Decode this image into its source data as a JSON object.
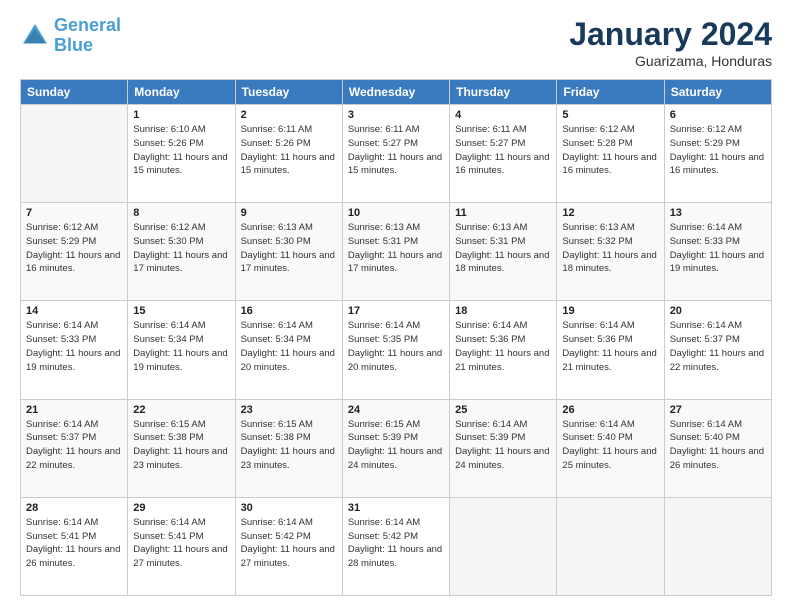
{
  "header": {
    "logo_line1": "General",
    "logo_line2": "Blue",
    "month": "January 2024",
    "location": "Guarizama, Honduras"
  },
  "days_of_week": [
    "Sunday",
    "Monday",
    "Tuesday",
    "Wednesday",
    "Thursday",
    "Friday",
    "Saturday"
  ],
  "weeks": [
    [
      {
        "date": "",
        "sunrise": "",
        "sunset": "",
        "daylight": ""
      },
      {
        "date": "1",
        "sunrise": "Sunrise: 6:10 AM",
        "sunset": "Sunset: 5:26 PM",
        "daylight": "Daylight: 11 hours and 15 minutes."
      },
      {
        "date": "2",
        "sunrise": "Sunrise: 6:11 AM",
        "sunset": "Sunset: 5:26 PM",
        "daylight": "Daylight: 11 hours and 15 minutes."
      },
      {
        "date": "3",
        "sunrise": "Sunrise: 6:11 AM",
        "sunset": "Sunset: 5:27 PM",
        "daylight": "Daylight: 11 hours and 15 minutes."
      },
      {
        "date": "4",
        "sunrise": "Sunrise: 6:11 AM",
        "sunset": "Sunset: 5:27 PM",
        "daylight": "Daylight: 11 hours and 16 minutes."
      },
      {
        "date": "5",
        "sunrise": "Sunrise: 6:12 AM",
        "sunset": "Sunset: 5:28 PM",
        "daylight": "Daylight: 11 hours and 16 minutes."
      },
      {
        "date": "6",
        "sunrise": "Sunrise: 6:12 AM",
        "sunset": "Sunset: 5:29 PM",
        "daylight": "Daylight: 11 hours and 16 minutes."
      }
    ],
    [
      {
        "date": "7",
        "sunrise": "Sunrise: 6:12 AM",
        "sunset": "Sunset: 5:29 PM",
        "daylight": "Daylight: 11 hours and 16 minutes."
      },
      {
        "date": "8",
        "sunrise": "Sunrise: 6:12 AM",
        "sunset": "Sunset: 5:30 PM",
        "daylight": "Daylight: 11 hours and 17 minutes."
      },
      {
        "date": "9",
        "sunrise": "Sunrise: 6:13 AM",
        "sunset": "Sunset: 5:30 PM",
        "daylight": "Daylight: 11 hours and 17 minutes."
      },
      {
        "date": "10",
        "sunrise": "Sunrise: 6:13 AM",
        "sunset": "Sunset: 5:31 PM",
        "daylight": "Daylight: 11 hours and 17 minutes."
      },
      {
        "date": "11",
        "sunrise": "Sunrise: 6:13 AM",
        "sunset": "Sunset: 5:31 PM",
        "daylight": "Daylight: 11 hours and 18 minutes."
      },
      {
        "date": "12",
        "sunrise": "Sunrise: 6:13 AM",
        "sunset": "Sunset: 5:32 PM",
        "daylight": "Daylight: 11 hours and 18 minutes."
      },
      {
        "date": "13",
        "sunrise": "Sunrise: 6:14 AM",
        "sunset": "Sunset: 5:33 PM",
        "daylight": "Daylight: 11 hours and 19 minutes."
      }
    ],
    [
      {
        "date": "14",
        "sunrise": "Sunrise: 6:14 AM",
        "sunset": "Sunset: 5:33 PM",
        "daylight": "Daylight: 11 hours and 19 minutes."
      },
      {
        "date": "15",
        "sunrise": "Sunrise: 6:14 AM",
        "sunset": "Sunset: 5:34 PM",
        "daylight": "Daylight: 11 hours and 19 minutes."
      },
      {
        "date": "16",
        "sunrise": "Sunrise: 6:14 AM",
        "sunset": "Sunset: 5:34 PM",
        "daylight": "Daylight: 11 hours and 20 minutes."
      },
      {
        "date": "17",
        "sunrise": "Sunrise: 6:14 AM",
        "sunset": "Sunset: 5:35 PM",
        "daylight": "Daylight: 11 hours and 20 minutes."
      },
      {
        "date": "18",
        "sunrise": "Sunrise: 6:14 AM",
        "sunset": "Sunset: 5:36 PM",
        "daylight": "Daylight: 11 hours and 21 minutes."
      },
      {
        "date": "19",
        "sunrise": "Sunrise: 6:14 AM",
        "sunset": "Sunset: 5:36 PM",
        "daylight": "Daylight: 11 hours and 21 minutes."
      },
      {
        "date": "20",
        "sunrise": "Sunrise: 6:14 AM",
        "sunset": "Sunset: 5:37 PM",
        "daylight": "Daylight: 11 hours and 22 minutes."
      }
    ],
    [
      {
        "date": "21",
        "sunrise": "Sunrise: 6:14 AM",
        "sunset": "Sunset: 5:37 PM",
        "daylight": "Daylight: 11 hours and 22 minutes."
      },
      {
        "date": "22",
        "sunrise": "Sunrise: 6:15 AM",
        "sunset": "Sunset: 5:38 PM",
        "daylight": "Daylight: 11 hours and 23 minutes."
      },
      {
        "date": "23",
        "sunrise": "Sunrise: 6:15 AM",
        "sunset": "Sunset: 5:38 PM",
        "daylight": "Daylight: 11 hours and 23 minutes."
      },
      {
        "date": "24",
        "sunrise": "Sunrise: 6:15 AM",
        "sunset": "Sunset: 5:39 PM",
        "daylight": "Daylight: 11 hours and 24 minutes."
      },
      {
        "date": "25",
        "sunrise": "Sunrise: 6:14 AM",
        "sunset": "Sunset: 5:39 PM",
        "daylight": "Daylight: 11 hours and 24 minutes."
      },
      {
        "date": "26",
        "sunrise": "Sunrise: 6:14 AM",
        "sunset": "Sunset: 5:40 PM",
        "daylight": "Daylight: 11 hours and 25 minutes."
      },
      {
        "date": "27",
        "sunrise": "Sunrise: 6:14 AM",
        "sunset": "Sunset: 5:40 PM",
        "daylight": "Daylight: 11 hours and 26 minutes."
      }
    ],
    [
      {
        "date": "28",
        "sunrise": "Sunrise: 6:14 AM",
        "sunset": "Sunset: 5:41 PM",
        "daylight": "Daylight: 11 hours and 26 minutes."
      },
      {
        "date": "29",
        "sunrise": "Sunrise: 6:14 AM",
        "sunset": "Sunset: 5:41 PM",
        "daylight": "Daylight: 11 hours and 27 minutes."
      },
      {
        "date": "30",
        "sunrise": "Sunrise: 6:14 AM",
        "sunset": "Sunset: 5:42 PM",
        "daylight": "Daylight: 11 hours and 27 minutes."
      },
      {
        "date": "31",
        "sunrise": "Sunrise: 6:14 AM",
        "sunset": "Sunset: 5:42 PM",
        "daylight": "Daylight: 11 hours and 28 minutes."
      },
      {
        "date": "",
        "sunrise": "",
        "sunset": "",
        "daylight": ""
      },
      {
        "date": "",
        "sunrise": "",
        "sunset": "",
        "daylight": ""
      },
      {
        "date": "",
        "sunrise": "",
        "sunset": "",
        "daylight": ""
      }
    ]
  ]
}
